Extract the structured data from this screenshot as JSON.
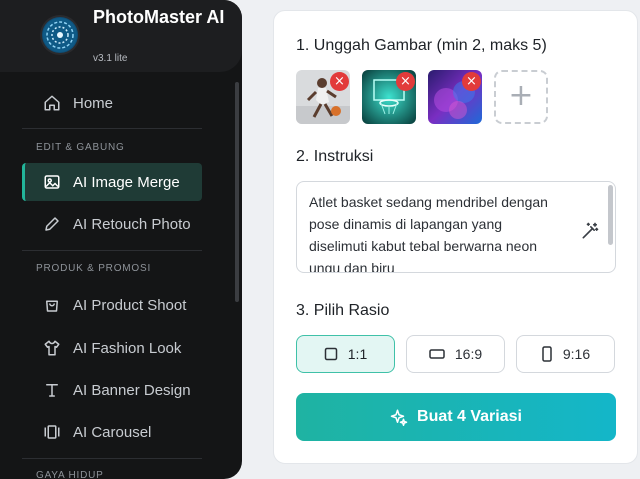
{
  "brand": {
    "title": "PhotoMaster AI",
    "version": "v3.1 lite"
  },
  "sidebar": {
    "home": "Home",
    "sections": [
      {
        "label": "EDIT & GABUNG",
        "items": [
          "AI Image Merge",
          "AI Retouch Photo"
        ]
      },
      {
        "label": "PRODUK & PROMOSI",
        "items": [
          "AI Product Shoot",
          "AI Fashion Look",
          "AI Banner Design",
          "AI Carousel"
        ]
      },
      {
        "label": "GAYA HIDUP",
        "items": []
      }
    ],
    "active_item": "AI Image Merge"
  },
  "upload": {
    "heading": "1. Unggah Gambar (min 2, maks 5)",
    "images": [
      "basketball-player",
      "neon-hoop",
      "purple-smoke"
    ],
    "remove_symbol": "×",
    "add_symbol": "+"
  },
  "instructions": {
    "heading": "2. Instruksi",
    "value": "Atlet basket sedang mendribel dengan pose dinamis di lapangan yang diselimuti kabut tebal berwarna neon ungu dan biru"
  },
  "ratio": {
    "heading": "3. Pilih Rasio",
    "options": [
      "1:1",
      "16:9",
      "9:16"
    ],
    "selected": "1:1"
  },
  "generate_button": "Buat 4 Variasi",
  "colors": {
    "accent": "#22b59a",
    "sidebar_bg": "#141516",
    "remove": "#e23b3b"
  }
}
